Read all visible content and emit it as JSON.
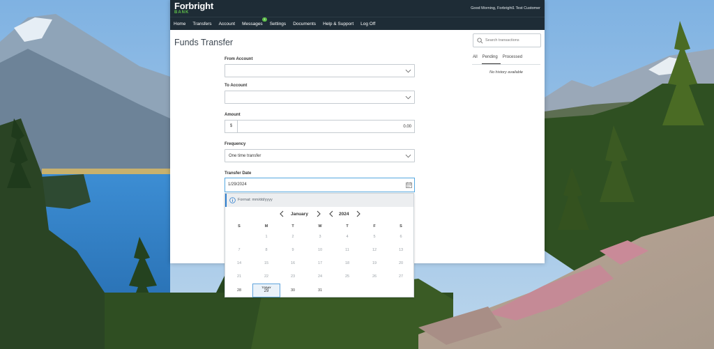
{
  "header": {
    "logo_name": "Forbright",
    "logo_sub": "BANK",
    "greeting": "Good Morning, Forbright1 Test Customer"
  },
  "nav": {
    "items": [
      {
        "label": "Home"
      },
      {
        "label": "Transfers"
      },
      {
        "label": "Account"
      },
      {
        "label": "Messages",
        "badge": "1"
      },
      {
        "label": "Settings"
      },
      {
        "label": "Documents"
      },
      {
        "label": "Help & Support"
      },
      {
        "label": "Log Off"
      }
    ]
  },
  "page": {
    "title": "Funds Transfer"
  },
  "form": {
    "from_account": {
      "label": "From Account",
      "value": ""
    },
    "to_account": {
      "label": "To Account",
      "value": ""
    },
    "amount": {
      "label": "Amount",
      "prefix": "$",
      "value": "0.00"
    },
    "frequency": {
      "label": "Frequency",
      "value": "One time transfer"
    },
    "transfer_date": {
      "label": "Transfer Date",
      "value": "1/29/2024"
    }
  },
  "datepicker": {
    "hint": "Format: mm/dd/yyyy",
    "month": "January",
    "year": "2024",
    "weekdays": [
      "S",
      "M",
      "T",
      "W",
      "T",
      "F",
      "S"
    ],
    "weeks": [
      [
        "",
        "1",
        "2",
        "3",
        "4",
        "5",
        "6"
      ],
      [
        "7",
        "8",
        "9",
        "10",
        "11",
        "12",
        "13"
      ],
      [
        "14",
        "15",
        "16",
        "17",
        "18",
        "19",
        "20"
      ],
      [
        "21",
        "22",
        "23",
        "24",
        "25",
        "26",
        "27"
      ],
      [
        "28",
        "29",
        "30",
        "31",
        "",
        "",
        ""
      ]
    ],
    "today_label": "TODAY",
    "today_day": "29"
  },
  "sidebar": {
    "search_placeholder": "Search transactions",
    "tabs": [
      {
        "label": "All",
        "active": false
      },
      {
        "label": "Pending",
        "active": true
      },
      {
        "label": "Processed",
        "active": false
      }
    ],
    "empty_text": "No history available"
  },
  "colors": {
    "header_bg": "#1e2c36",
    "brand_green": "#5fbf4a",
    "focus_blue": "#55a8e0",
    "info_blue": "#2f7fcf"
  }
}
